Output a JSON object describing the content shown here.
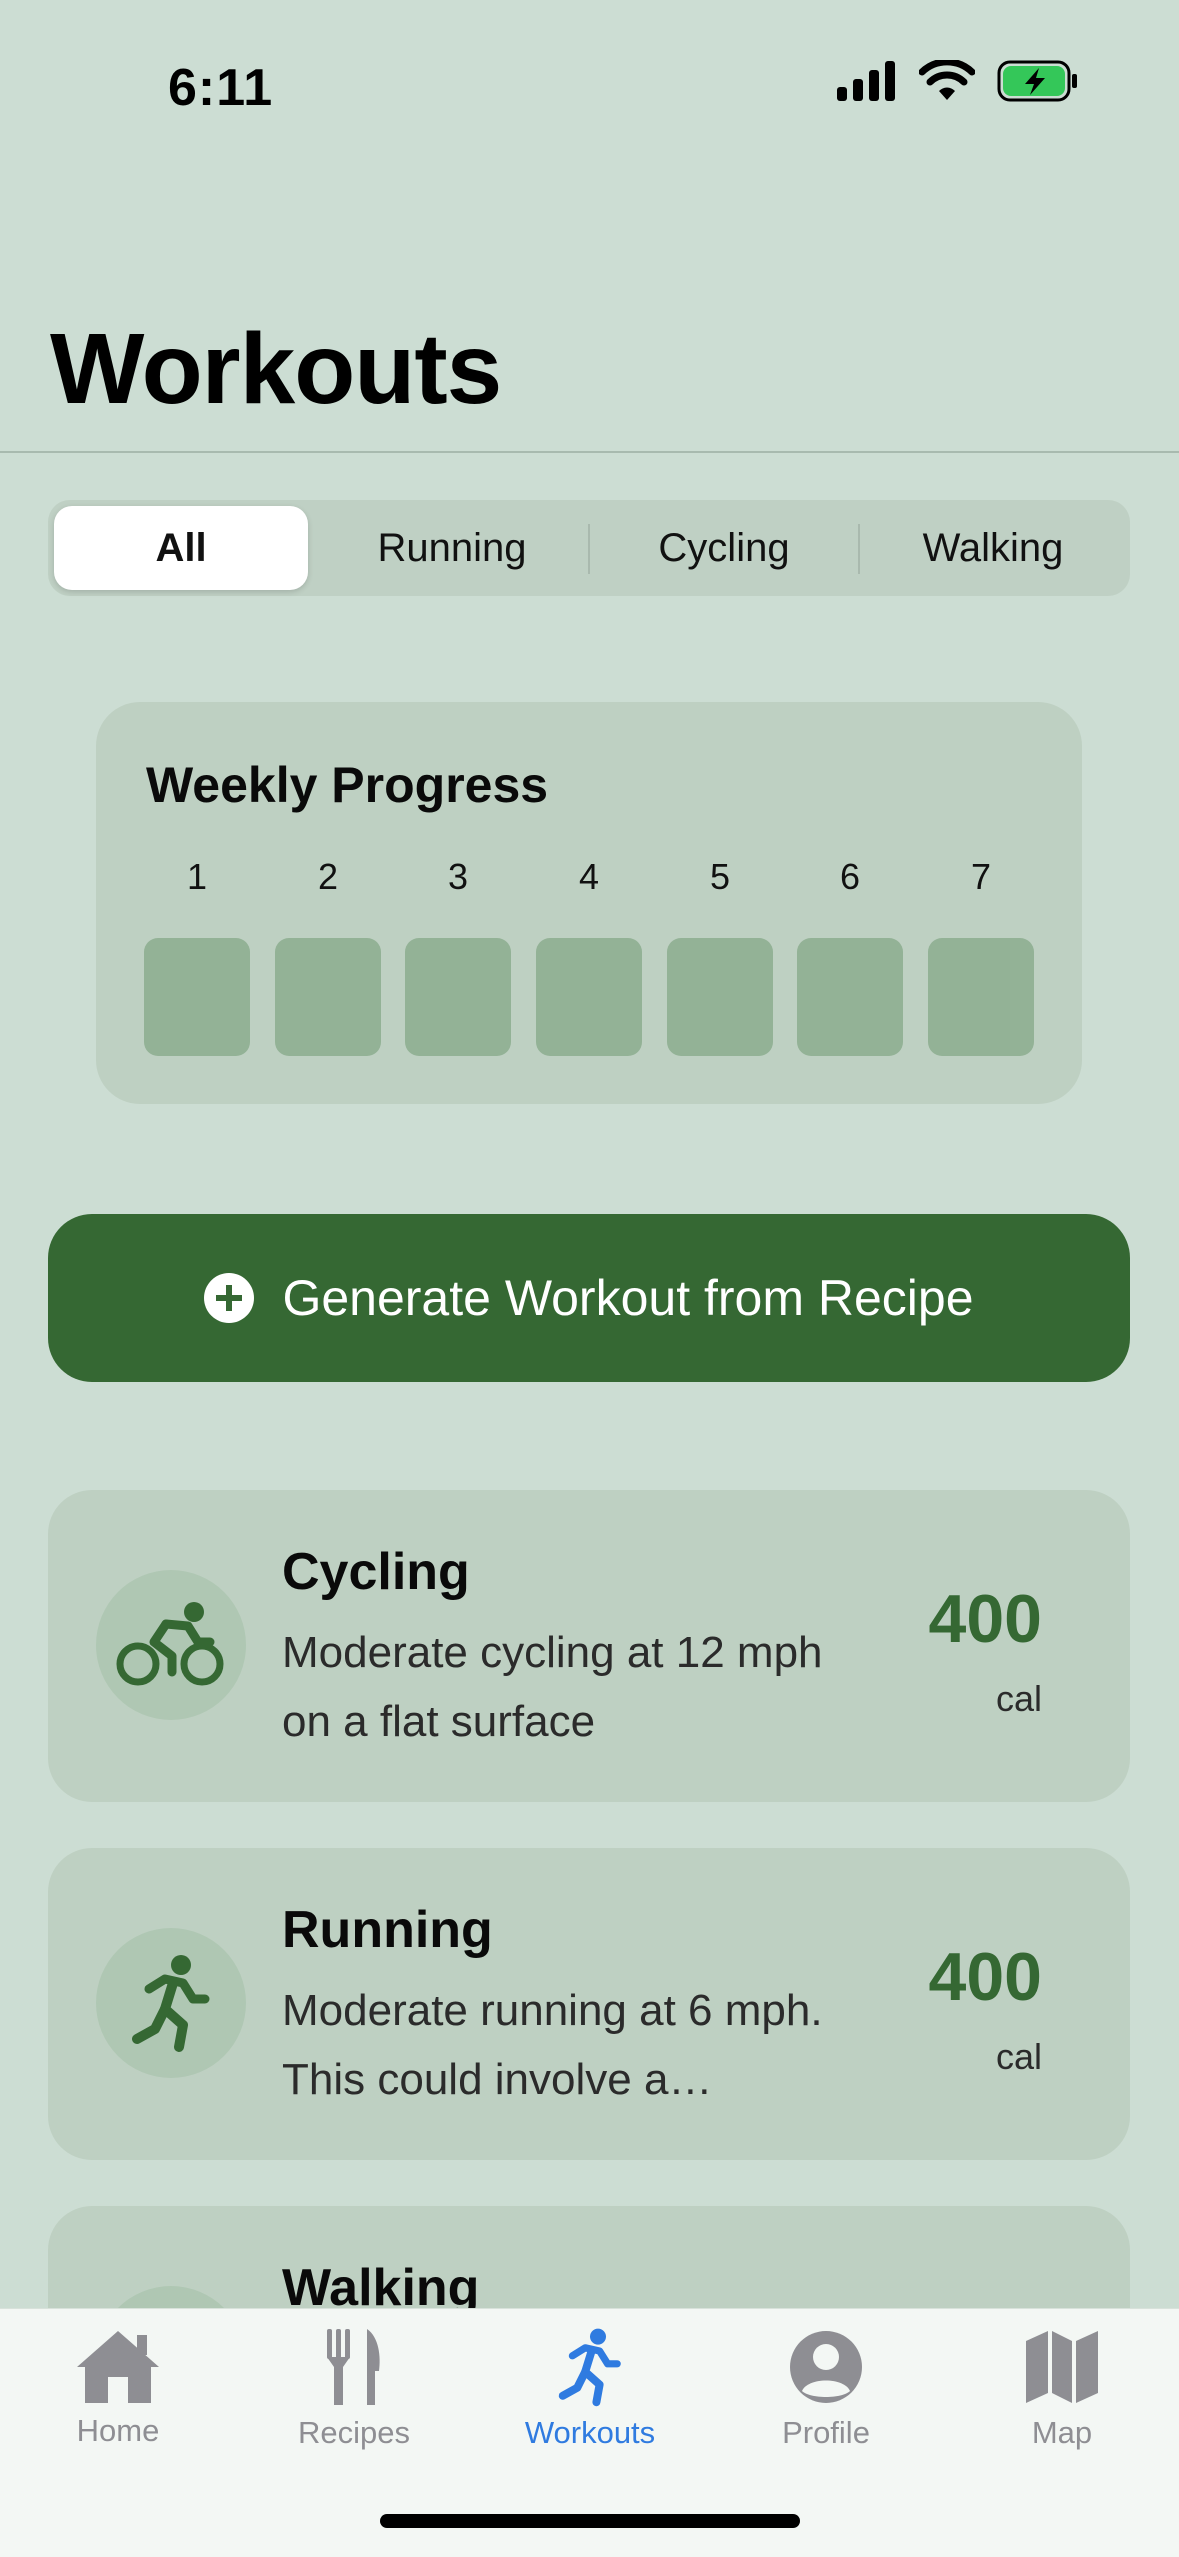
{
  "status_bar": {
    "time": "6:11"
  },
  "header": {
    "title": "Workouts"
  },
  "filters": {
    "segments": [
      "All",
      "Running",
      "Cycling",
      "Walking"
    ],
    "selected": "All"
  },
  "weekly_progress": {
    "title": "Weekly Progress",
    "days": [
      "1",
      "2",
      "3",
      "4",
      "5",
      "6",
      "7"
    ]
  },
  "generate_button": {
    "label": "Generate Workout from Recipe"
  },
  "workouts": [
    {
      "title": "Cycling",
      "description": "Moderate cycling at 12 mph on a flat surface",
      "calories": "400",
      "unit": "cal",
      "icon": "bicycle-icon"
    },
    {
      "title": "Running",
      "description": "Moderate running at 6 mph. This could involve a…",
      "calories": "400",
      "unit": "cal",
      "icon": "running-icon"
    },
    {
      "title": "Walking",
      "description": "",
      "calories": "",
      "unit": "",
      "icon": "walking-icon"
    }
  ],
  "tabbar": {
    "tabs": [
      {
        "label": "Home",
        "icon": "home-icon"
      },
      {
        "label": "Recipes",
        "icon": "fork-knife-icon"
      },
      {
        "label": "Workouts",
        "icon": "running-icon"
      },
      {
        "label": "Profile",
        "icon": "profile-icon"
      },
      {
        "label": "Map",
        "icon": "map-icon"
      }
    ],
    "active": "Workouts"
  },
  "colors": {
    "background": "#CCDDD3",
    "accent_green": "#356833",
    "tab_active": "#2F7BE0",
    "tab_inactive": "#8E8E93"
  }
}
